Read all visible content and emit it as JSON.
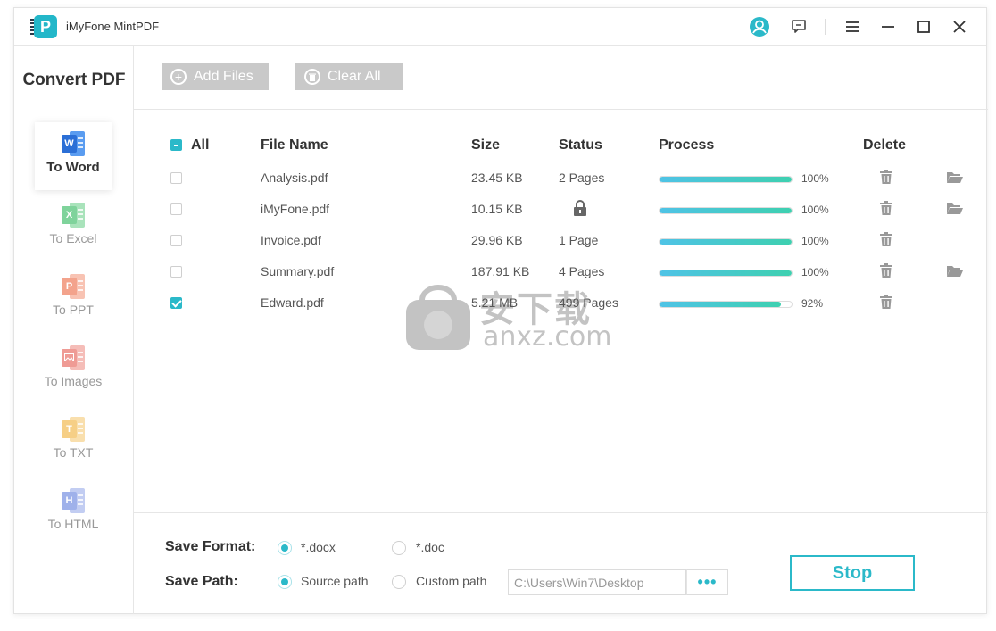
{
  "app": {
    "title": "iMyFone MintPDF",
    "logo_letter": "P",
    "accent": "#2bb9c9"
  },
  "titlebar": {
    "icons": [
      "account-icon",
      "feedback-icon",
      "menu-icon",
      "minimize-icon",
      "maximize-icon",
      "close-icon"
    ]
  },
  "sidebar": {
    "title": "Convert PDF",
    "items": [
      {
        "label": "To Word",
        "letter": "W",
        "color": "#2b6fd6",
        "active": true
      },
      {
        "label": "To Excel",
        "letter": "X",
        "color": "#7fd39b",
        "active": false
      },
      {
        "label": "To PPT",
        "letter": "P",
        "color": "#f3a38c",
        "active": false
      },
      {
        "label": "To Images",
        "letter": "",
        "color": "#ef9b95",
        "active": false
      },
      {
        "label": "To TXT",
        "letter": "T",
        "color": "#f6cf86",
        "active": false
      },
      {
        "label": "To HTML",
        "letter": "H",
        "color": "#9fb1ea",
        "active": false
      }
    ]
  },
  "toolbar": {
    "add_label": "Add Files",
    "clear_label": "Clear All"
  },
  "table": {
    "headers": {
      "all": "All",
      "file_name": "File Name",
      "size": "Size",
      "status": "Status",
      "process": "Process",
      "delete": "Delete"
    },
    "rows": [
      {
        "checked": false,
        "name": "Analysis.pdf",
        "size": "23.45 KB",
        "status": "2 Pages",
        "locked": false,
        "progress": 100,
        "progress_label": "100%",
        "folder": true
      },
      {
        "checked": false,
        "name": "iMyFone.pdf",
        "size": "10.15 KB",
        "status": "",
        "locked": true,
        "progress": 100,
        "progress_label": "100%",
        "folder": true
      },
      {
        "checked": false,
        "name": "Invoice.pdf",
        "size": "29.96 KB",
        "status": "1 Page",
        "locked": false,
        "progress": 100,
        "progress_label": "100%",
        "folder": false
      },
      {
        "checked": false,
        "name": "Summary.pdf",
        "size": "187.91 KB",
        "status": "4 Pages",
        "locked": false,
        "progress": 100,
        "progress_label": "100%",
        "folder": true
      },
      {
        "checked": true,
        "name": "Edward.pdf",
        "size": "5.21 MB",
        "status": "499 Pages",
        "locked": false,
        "progress": 92,
        "progress_label": "92%",
        "folder": false
      }
    ]
  },
  "watermark": {
    "text_cn": "安下载",
    "text_en": "anxz.com"
  },
  "bottom": {
    "format_label": "Save Format:",
    "format_options": [
      {
        "label": "*.docx",
        "selected": true
      },
      {
        "label": "*.doc",
        "selected": false
      }
    ],
    "path_label": "Save Path:",
    "path_options": [
      {
        "label": "Source path",
        "selected": true
      },
      {
        "label": "Custom path",
        "selected": false
      }
    ],
    "path_value": "C:\\Users\\Win7\\Desktop",
    "more_label": "•••",
    "stop_label": "Stop"
  }
}
